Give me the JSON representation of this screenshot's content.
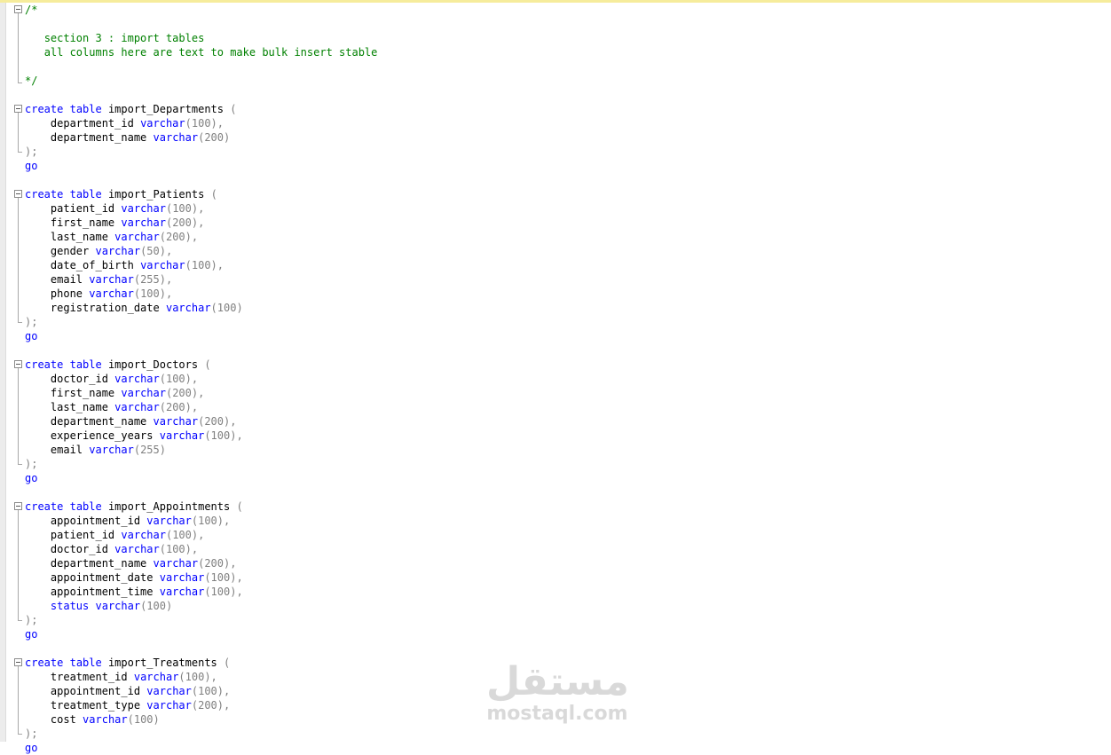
{
  "editor": {
    "comment_block": {
      "open": "/*",
      "line1": "section 3 : import tables",
      "line2": "all columns here are text to make bulk insert stable",
      "close": "*/"
    },
    "keywords": {
      "create": "create",
      "table": "table",
      "type": "varchar",
      "go": "go"
    },
    "tables": [
      {
        "name": "import_Departments",
        "columns": [
          {
            "name": "department_id",
            "size": "(100)",
            "sep": ","
          },
          {
            "name": "department_name",
            "size": "(200)",
            "sep": ""
          }
        ]
      },
      {
        "name": "import_Patients",
        "columns": [
          {
            "name": "patient_id",
            "size": "(100)",
            "sep": ","
          },
          {
            "name": "first_name",
            "size": "(200)",
            "sep": ","
          },
          {
            "name": "last_name",
            "size": "(200)",
            "sep": ","
          },
          {
            "name": "gender",
            "size": "(50)",
            "sep": ","
          },
          {
            "name": "date_of_birth",
            "size": "(100)",
            "sep": ","
          },
          {
            "name": "email",
            "size": "(255)",
            "sep": ","
          },
          {
            "name": "phone",
            "size": "(100)",
            "sep": ","
          },
          {
            "name": "registration_date",
            "size": "(100)",
            "sep": ""
          }
        ]
      },
      {
        "name": "import_Doctors",
        "columns": [
          {
            "name": "doctor_id",
            "size": "(100)",
            "sep": ","
          },
          {
            "name": "first_name",
            "size": "(200)",
            "sep": ","
          },
          {
            "name": "last_name",
            "size": "(200)",
            "sep": ","
          },
          {
            "name": "department_name",
            "size": "(200)",
            "sep": ","
          },
          {
            "name": "experience_years",
            "size": "(100)",
            "sep": ","
          },
          {
            "name": "email",
            "size": "(255)",
            "sep": ""
          }
        ]
      },
      {
        "name": "import_Appointments",
        "columns": [
          {
            "name": "appointment_id",
            "size": "(100)",
            "sep": ","
          },
          {
            "name": "patient_id",
            "size": "(100)",
            "sep": ","
          },
          {
            "name": "doctor_id",
            "size": "(100)",
            "sep": ","
          },
          {
            "name": "department_name",
            "size": "(200)",
            "sep": ","
          },
          {
            "name": "appointment_date",
            "size": "(100)",
            "sep": ","
          },
          {
            "name": "appointment_time",
            "size": "(100)",
            "sep": ","
          },
          {
            "name": "status",
            "size": "(100)",
            "sep": "",
            "name_is_keyword": true
          }
        ]
      },
      {
        "name": "import_Treatments",
        "columns": [
          {
            "name": "treatment_id",
            "size": "(100)",
            "sep": ","
          },
          {
            "name": "appointment_id",
            "size": "(100)",
            "sep": ","
          },
          {
            "name": "treatment_type",
            "size": "(200)",
            "sep": ","
          },
          {
            "name": "cost",
            "size": "(100)",
            "sep": ""
          }
        ]
      }
    ],
    "open_paren": "(",
    "close_stmt": ");"
  },
  "watermark": {
    "arabic": "مستقل",
    "latin": "mostaql.com"
  },
  "colors": {
    "keyword": "#0000ff",
    "comment": "#008000",
    "punctuation": "#808080",
    "text": "#000000"
  }
}
